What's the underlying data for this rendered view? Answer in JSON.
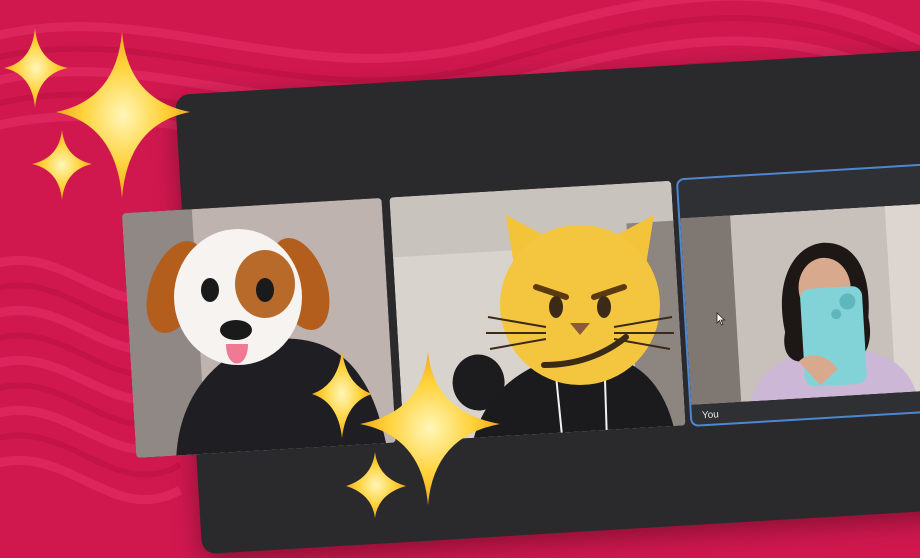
{
  "call": {
    "participants": [
      {
        "id": "participant-1",
        "name": "",
        "avatar_overlay": "dog-emoji-icon"
      },
      {
        "id": "participant-2",
        "name": "",
        "avatar_overlay": "cat-emoji-icon"
      },
      {
        "id": "participant-self",
        "name": "You",
        "active_speaker": true
      }
    ]
  },
  "colors": {
    "background": "#d0184f",
    "window": "#2a2a2c",
    "active_border": "#4e86d4",
    "sparkle": "#ffd23a"
  }
}
